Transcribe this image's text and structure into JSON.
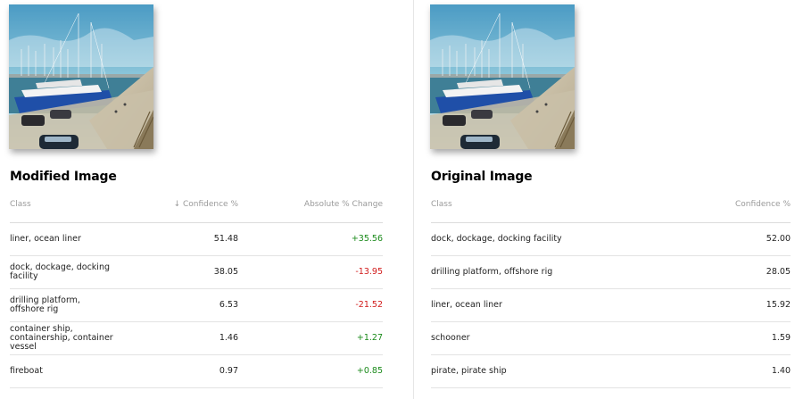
{
  "left": {
    "title": "Modified Image",
    "headers": {
      "class": "Class",
      "confidence": "↓ Confidence %",
      "change": "Absolute % Change"
    },
    "rows": [
      {
        "class": "liner, ocean liner",
        "confidence": "51.48",
        "change": "+35.56",
        "direction": "pos"
      },
      {
        "class": "dock, dockage, docking facility",
        "confidence": "38.05",
        "change": "-13.95",
        "direction": "neg"
      },
      {
        "class": "drilling platform, offshore rig",
        "confidence": "6.53",
        "change": "-21.52",
        "direction": "neg"
      },
      {
        "class": "container ship, containership, container vessel",
        "confidence": "1.46",
        "change": "+1.27",
        "direction": "pos"
      },
      {
        "class": "fireboat",
        "confidence": "0.97",
        "change": "+0.85",
        "direction": "pos"
      }
    ]
  },
  "right": {
    "title": "Original Image",
    "headers": {
      "class": "Class",
      "confidence": "Confidence %"
    },
    "rows": [
      {
        "class": "dock, dockage, docking facility",
        "confidence": "52.00"
      },
      {
        "class": "drilling platform, offshore rig",
        "confidence": "28.05"
      },
      {
        "class": "liner, ocean liner",
        "confidence": "15.92"
      },
      {
        "class": "schooner",
        "confidence": "1.59"
      },
      {
        "class": "pirate, pirate ship",
        "confidence": "1.40"
      }
    ]
  },
  "colors": {
    "positive": "#1a8a1a",
    "negative": "#d11a1a",
    "header_text": "#9a9a9a"
  }
}
